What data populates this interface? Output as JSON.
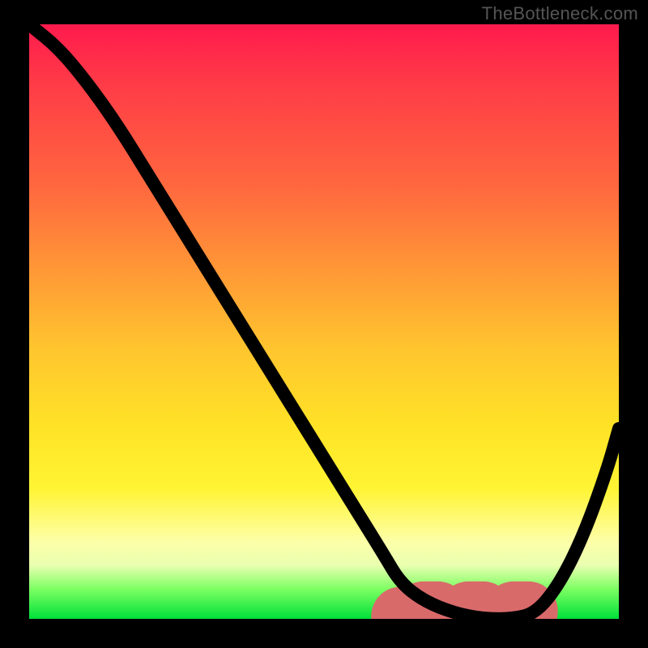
{
  "watermark": "TheBottleneck.com",
  "chart_data": {
    "type": "line",
    "title": "",
    "xlabel": "",
    "ylabel": "",
    "xlim": [
      0,
      100
    ],
    "ylim": [
      0,
      100
    ],
    "grid": false,
    "series": [
      {
        "name": "curve",
        "x": [
          0,
          5,
          10,
          15,
          20,
          25,
          30,
          35,
          40,
          45,
          50,
          55,
          60,
          63,
          67,
          72,
          77,
          82,
          86,
          90,
          94,
          98,
          100
        ],
        "values": [
          100,
          96,
          90,
          83,
          75,
          67,
          59,
          51,
          43,
          35,
          27,
          19,
          11,
          6,
          3,
          1,
          0,
          0,
          1,
          6,
          14,
          25,
          32
        ]
      }
    ],
    "valley_marker": {
      "x_start": 63,
      "x_end": 86,
      "y": 1
    },
    "colors": {
      "curve": "#000000",
      "marker": "#d96a6a",
      "gradient_top": "#ff1a4d",
      "gradient_mid": "#ffe326",
      "gradient_bottom": "#00e03a",
      "frame": "#000000"
    }
  }
}
